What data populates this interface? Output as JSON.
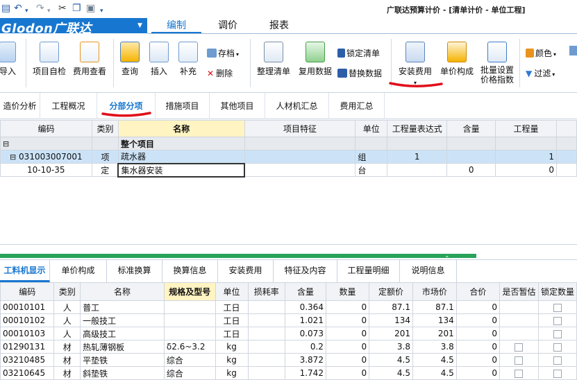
{
  "window": {
    "title": "广联达预算计价 - [清单计价 - 单位工程]"
  },
  "brand": {
    "logo": "Glodon广联达"
  },
  "menu_tabs": [
    "编制",
    "调价",
    "报表"
  ],
  "ribbon": {
    "import": "导入",
    "project_check": "项目自检",
    "fee_view": "费用查看",
    "query": "查询",
    "insert": "插入",
    "supplement": "补充",
    "save": "存档",
    "delete": "删除",
    "organize_list": "整理清单",
    "reuse_data": "复用数据",
    "lock_list": "锁定清单",
    "replace_data": "替换数据",
    "install_fee": "安装费用",
    "unit_price": "单价构成",
    "batch_set_1": "批量设置",
    "batch_set_2": "价格指数",
    "color": "颜色",
    "filter": "过滤"
  },
  "sub_tabs": [
    "造价分析",
    "工程概况",
    "分部分项",
    "措施项目",
    "其他项目",
    "人材机汇总",
    "费用汇总"
  ],
  "top_grid": {
    "headers": [
      "编码",
      "类别",
      "名称",
      "项目特征",
      "单位",
      "工程量表达式",
      "含量",
      "工程量"
    ],
    "root": {
      "name": "整个项目"
    },
    "rows": [
      {
        "code": "031003007001",
        "type": "项",
        "name": "疏水器",
        "feature": "",
        "unit": "组",
        "expr": "1",
        "content": "",
        "qty": "1"
      },
      {
        "code": "10-10-35",
        "type": "定",
        "name": "集水器安装",
        "feature": "",
        "unit": "台",
        "expr": "",
        "content": "0",
        "qty": "0"
      }
    ]
  },
  "lower_tabs": [
    "工料机显示",
    "单价构成",
    "标准换算",
    "换算信息",
    "安装费用",
    "特征及内容",
    "工程量明细",
    "说明信息"
  ],
  "bottom_grid": {
    "headers": [
      "编码",
      "类别",
      "名称",
      "规格及型号",
      "单位",
      "损耗率",
      "含量",
      "数量",
      "定额价",
      "市场价",
      "合价",
      "是否暂估",
      "锁定数量"
    ],
    "rows": [
      {
        "code": "00010101",
        "type": "人",
        "name": "普工",
        "spec": "",
        "unit": "工日",
        "loss": "",
        "content": "0.364",
        "qty": "0",
        "quota": "87.1",
        "market": "87.1",
        "total": "0",
        "est": false,
        "lock": true
      },
      {
        "code": "00010102",
        "type": "人",
        "name": "一般技工",
        "spec": "",
        "unit": "工日",
        "loss": "",
        "content": "1.021",
        "qty": "0",
        "quota": "134",
        "market": "134",
        "total": "0",
        "est": false,
        "lock": true
      },
      {
        "code": "00010103",
        "type": "人",
        "name": "高级技工",
        "spec": "",
        "unit": "工日",
        "loss": "",
        "content": "0.073",
        "qty": "0",
        "quota": "201",
        "market": "201",
        "total": "0",
        "est": false,
        "lock": true
      },
      {
        "code": "01290131",
        "type": "材",
        "name": "热轧薄钢板",
        "spec": "δ2.6~3.2",
        "unit": "kg",
        "loss": "",
        "content": "0.2",
        "qty": "0",
        "quota": "3.8",
        "market": "3.8",
        "total": "0",
        "est": true,
        "lock": true
      },
      {
        "code": "03210485",
        "type": "材",
        "name": "平垫铁",
        "spec": "综合",
        "unit": "kg",
        "loss": "",
        "content": "3.872",
        "qty": "0",
        "quota": "4.5",
        "market": "4.5",
        "total": "0",
        "est": true,
        "lock": true
      },
      {
        "code": "03210645",
        "type": "材",
        "name": "斜垫铁",
        "spec": "综合",
        "unit": "kg",
        "loss": "",
        "content": "1.742",
        "qty": "0",
        "quota": "4.5",
        "market": "4.5",
        "total": "0",
        "est": true,
        "lock": true
      }
    ]
  },
  "colors": {
    "brand_blue": "#1777d0",
    "highlight_row": "#cce3f7",
    "annotation_red": "#e0101a",
    "header_yellow": "#fff4c2"
  }
}
